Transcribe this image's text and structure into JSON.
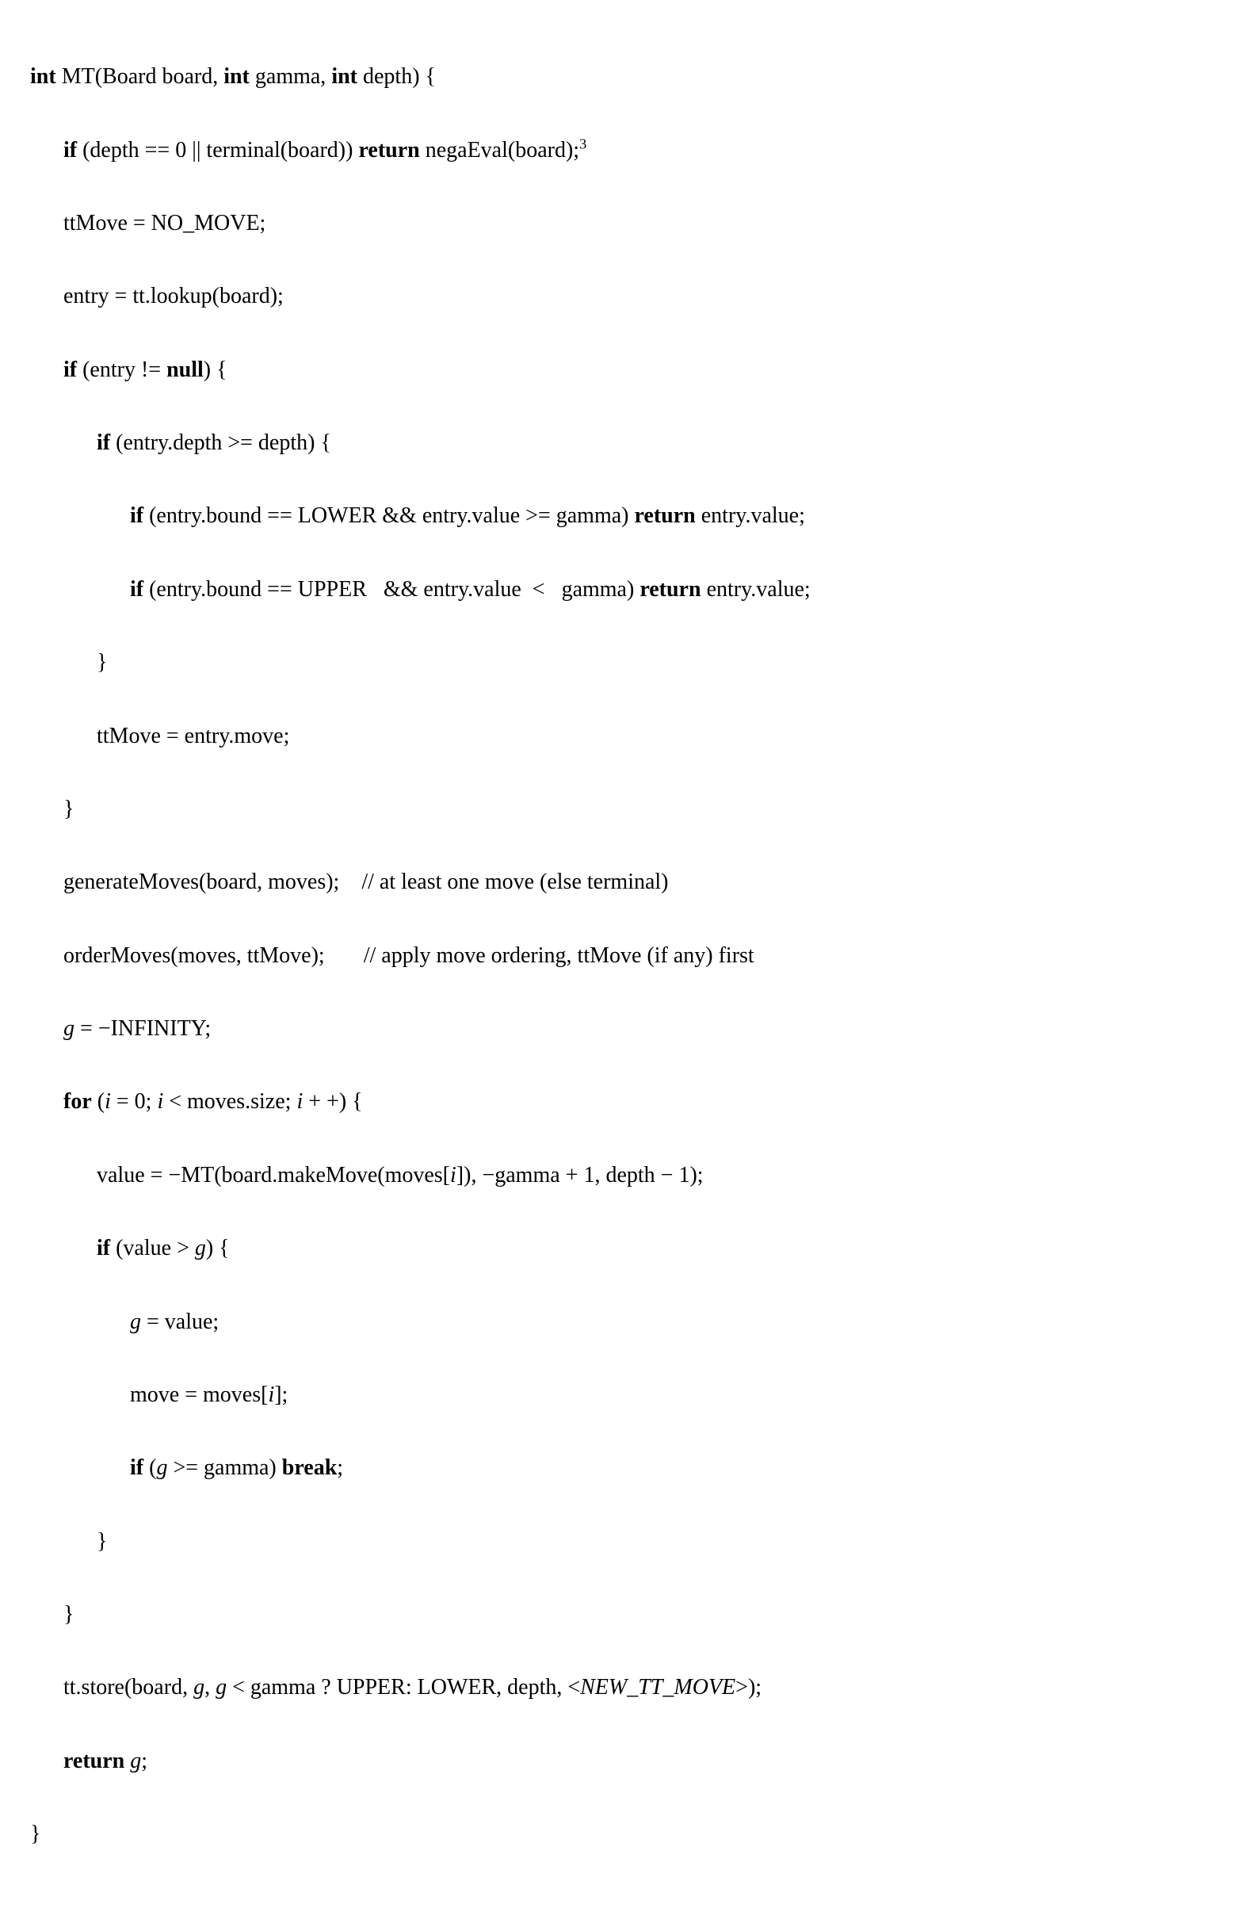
{
  "algo": {
    "l1_int": "int",
    "l1_rest": " MT(Board board, ",
    "l1_int2": "int",
    "l1_rest2": " gamma, ",
    "l1_int3": "int",
    "l1_rest3": " depth) {",
    "l2_if": "if",
    "l2_cond": " (depth == 0 || terminal(board)) ",
    "l2_ret": "return",
    "l2_rest": " negaEval(board);",
    "l2_sup": "3",
    "l3": "ttMove = NO_MOVE;",
    "l4": "entry = tt.lookup(board);",
    "l5_if": "if",
    "l5_mid": " (entry != ",
    "l5_null": "null",
    "l5_end": ") {",
    "l6_if": "if",
    "l6_rest": " (entry.depth >= depth) {",
    "l7_if": "if",
    "l7_cond": " (entry.bound == LOWER && entry.value >= gamma) ",
    "l7_ret": "return",
    "l7_rest": " entry.value;",
    "l8_if": "if",
    "l8_cond": " (entry.bound == UPPER   && entry.value  <   gamma) ",
    "l8_ret": "return",
    "l8_rest": " entry.value;",
    "l9": "}",
    "l10": "ttMove = entry.move;",
    "l11": "}",
    "l12": "generateMoves(board, moves);    // at least one move (else terminal)",
    "l13": "orderMoves(moves, ttMove);       // apply move ordering, ttMove (if any) first",
    "l14_g": "g",
    "l14_rest": " = −INFINITY;",
    "l15_for": "for",
    "l15_p1": " (",
    "l15_i1": "i",
    "l15_p2": " = 0; ",
    "l15_i2": "i",
    "l15_p3": " < moves.size; ",
    "l15_i3": "i",
    "l15_p4": " + +) {",
    "l16_a": "value = −MT(board.makeMove(moves[",
    "l16_i": "i",
    "l16_b": "]), −gamma + 1, depth − 1);",
    "l17_if": "if",
    "l17_mid": " (value > ",
    "l17_g": "g",
    "l17_end": ") {",
    "l18_g": "g",
    "l18_rest": " = value;",
    "l19_a": "move = moves[",
    "l19_i": "i",
    "l19_b": "];",
    "l20_if": "if",
    "l20_p1": " (",
    "l20_g": "g",
    "l20_p2": " >= gamma) ",
    "l20_break": "break",
    "l20_end": ";",
    "l21": "}",
    "l22": "}",
    "l23_a": "tt.store(board, ",
    "l23_g1": "g",
    "l23_b": ", ",
    "l23_g2": "g",
    "l23_c": " < gamma ? UPPER: LOWER, depth, <",
    "l23_it": "NEW_TT_MOVE",
    "l23_d": ">);",
    "l24_ret": "return",
    "l24_sp": " ",
    "l24_g": "g",
    "l24_end": ";",
    "l25": "}"
  }
}
